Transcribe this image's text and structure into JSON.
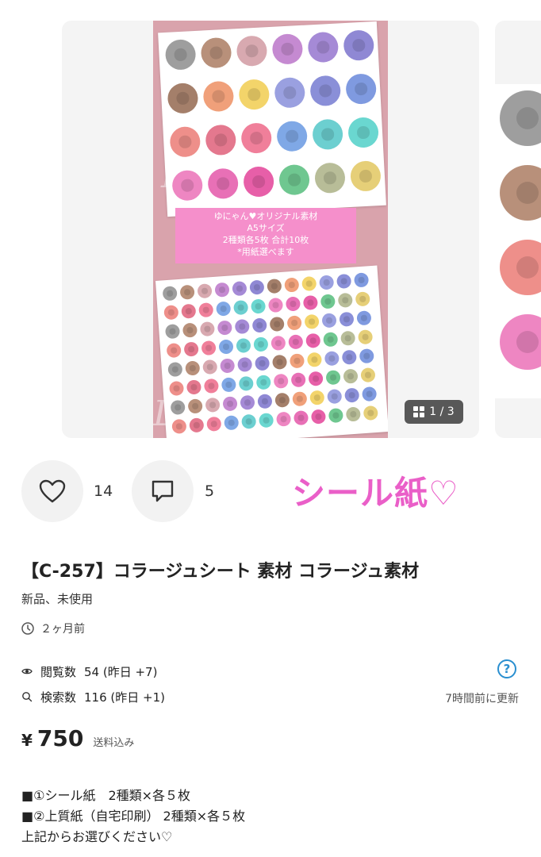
{
  "gallery": {
    "page_indicator": "1 / 3",
    "image_text": {
      "line1": "ゆにゃん♥オリジナル素材",
      "line2": "A5サイズ",
      "line3": "2種類各5枚 合計10枚",
      "line4": "*用紙選べます",
      "watermark": "PIC•COLLAGE"
    },
    "rose_colors": [
      "#9e9e9e",
      "#b8907a",
      "#d8a9b0",
      "#c58ad1",
      "#a58ad6",
      "#8f88d4",
      "#a47f6a",
      "#f0a07a",
      "#f3d46a",
      "#9aa0e0",
      "#8a8fd8",
      "#7f9ae0",
      "#ee8f8a",
      "#e4788e",
      "#f07f9a",
      "#7fa8e6",
      "#6ccfd0",
      "#6ad7d0",
      "#ee86c2",
      "#e870b6",
      "#e75fa8",
      "#6fc790",
      "#b8bd98",
      "#e6cf78"
    ]
  },
  "actions": {
    "likes": "14",
    "comments": "5",
    "banner_text": "シール紙♡"
  },
  "item": {
    "title": "【C-257】コラージュシート 素材 コラージュ素材",
    "condition": "新品、未使用",
    "posted": "２ヶ月前",
    "views_label": "閲覧数",
    "views_value": "54 (昨日 +7)",
    "searches_label": "検索数",
    "searches_value": "116 (昨日 +1)",
    "updated": "7時間前に更新",
    "currency": "¥",
    "price": "750",
    "shipping_note": "送料込み",
    "description": [
      "■①シール紙　2種類×各５枚",
      "■②上質紙（自宅印刷）  2種類×各５枚",
      "上記からお選びください♡"
    ]
  }
}
